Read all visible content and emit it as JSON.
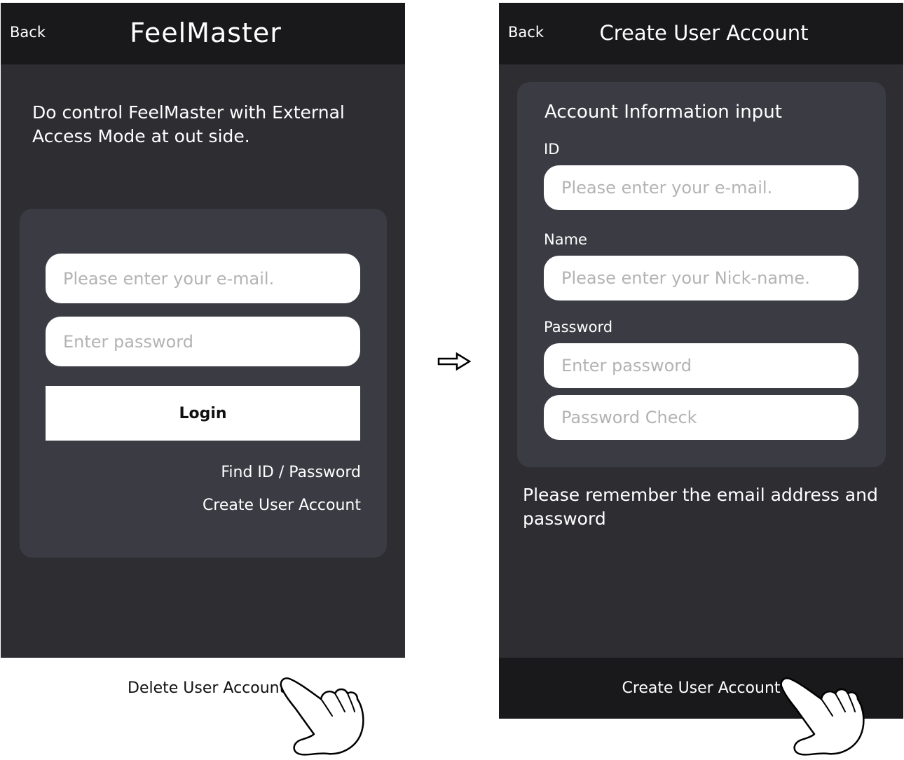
{
  "login_screen": {
    "back_label": "Back",
    "app_title": "FeelMaster",
    "intro_text": "Do control FeelMaster with External Access Mode at out side.",
    "email_placeholder": "Please enter your e-mail.",
    "password_placeholder": "Enter password",
    "login_label": "Login",
    "find_link": "Find ID / Password",
    "create_link": "Create User Account",
    "delete_link": "Delete User Account"
  },
  "create_screen": {
    "back_label": "Back",
    "title": "Create User Account",
    "card_heading": "Account Information input",
    "id_label": "ID",
    "id_placeholder": "Please enter your e-mail.",
    "name_label": "Name",
    "name_placeholder": "Please enter your Nick-name.",
    "password_label": "Password",
    "password_placeholder": "Enter password",
    "password_check_placeholder": "Password Check",
    "notice": "Please remember the email address and password",
    "submit_label": "Create User Account"
  },
  "icons": {
    "transition_arrow": "right-arrow-icon",
    "pointer": "pointing-hand-icon"
  },
  "colors": {
    "screen_bg": "#2d2d32",
    "bar_bg": "#19191c",
    "card_bg": "#3b3b44",
    "field_bg": "#ffffff",
    "placeholder": "#b3b3b3"
  }
}
